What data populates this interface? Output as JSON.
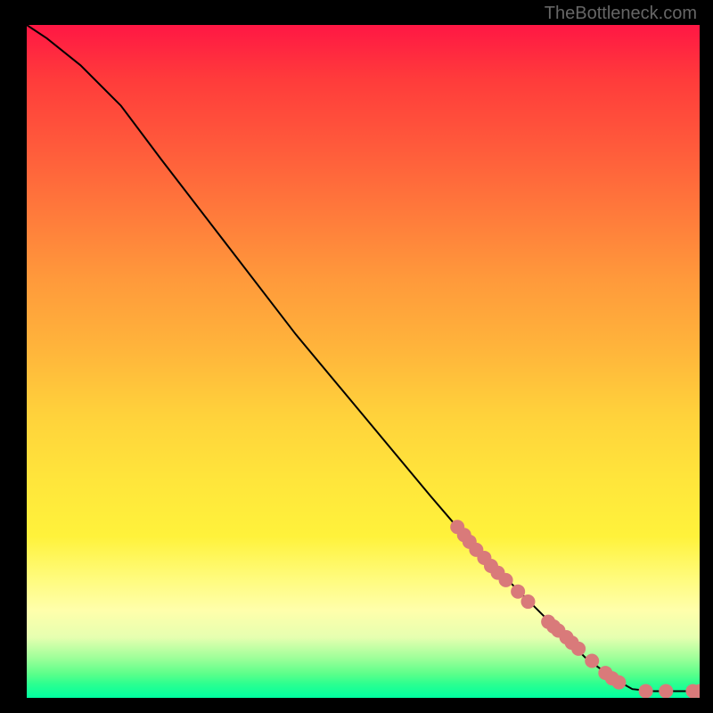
{
  "watermark": "TheBottleneck.com",
  "chart_data": {
    "type": "line",
    "title": "",
    "xlabel": "",
    "ylabel": "",
    "xlim": [
      0,
      100
    ],
    "ylim": [
      0,
      100
    ],
    "curve": [
      {
        "x": 0,
        "y": 100
      },
      {
        "x": 3,
        "y": 98
      },
      {
        "x": 8,
        "y": 94
      },
      {
        "x": 14,
        "y": 88
      },
      {
        "x": 20,
        "y": 80
      },
      {
        "x": 30,
        "y": 67
      },
      {
        "x": 40,
        "y": 54
      },
      {
        "x": 50,
        "y": 42
      },
      {
        "x": 60,
        "y": 30
      },
      {
        "x": 66,
        "y": 23
      },
      {
        "x": 72,
        "y": 17
      },
      {
        "x": 78,
        "y": 11
      },
      {
        "x": 83,
        "y": 6
      },
      {
        "x": 87,
        "y": 3
      },
      {
        "x": 90,
        "y": 1.3
      },
      {
        "x": 93,
        "y": 1.0
      },
      {
        "x": 96,
        "y": 1.0
      },
      {
        "x": 100,
        "y": 1.0
      }
    ],
    "markers": [
      {
        "x": 64,
        "y": 25.4
      },
      {
        "x": 65,
        "y": 24.2
      },
      {
        "x": 65.8,
        "y": 23.2
      },
      {
        "x": 66.8,
        "y": 22.0
      },
      {
        "x": 68,
        "y": 20.8
      },
      {
        "x": 69,
        "y": 19.6
      },
      {
        "x": 70,
        "y": 18.6
      },
      {
        "x": 71.2,
        "y": 17.5
      },
      {
        "x": 73,
        "y": 15.8
      },
      {
        "x": 74.5,
        "y": 14.3
      },
      {
        "x": 77.5,
        "y": 11.3
      },
      {
        "x": 78.3,
        "y": 10.6
      },
      {
        "x": 79,
        "y": 10.0
      },
      {
        "x": 80.2,
        "y": 9.0
      },
      {
        "x": 81,
        "y": 8.2
      },
      {
        "x": 82,
        "y": 7.3
      },
      {
        "x": 84,
        "y": 5.5
      },
      {
        "x": 86,
        "y": 3.7
      },
      {
        "x": 87,
        "y": 2.9
      },
      {
        "x": 88,
        "y": 2.3
      },
      {
        "x": 92,
        "y": 1.0
      },
      {
        "x": 95,
        "y": 1.0
      },
      {
        "x": 99,
        "y": 1.0
      },
      {
        "x": 100,
        "y": 1.0
      }
    ],
    "marker_color": "#d97a7a",
    "line_color": "#000000"
  }
}
